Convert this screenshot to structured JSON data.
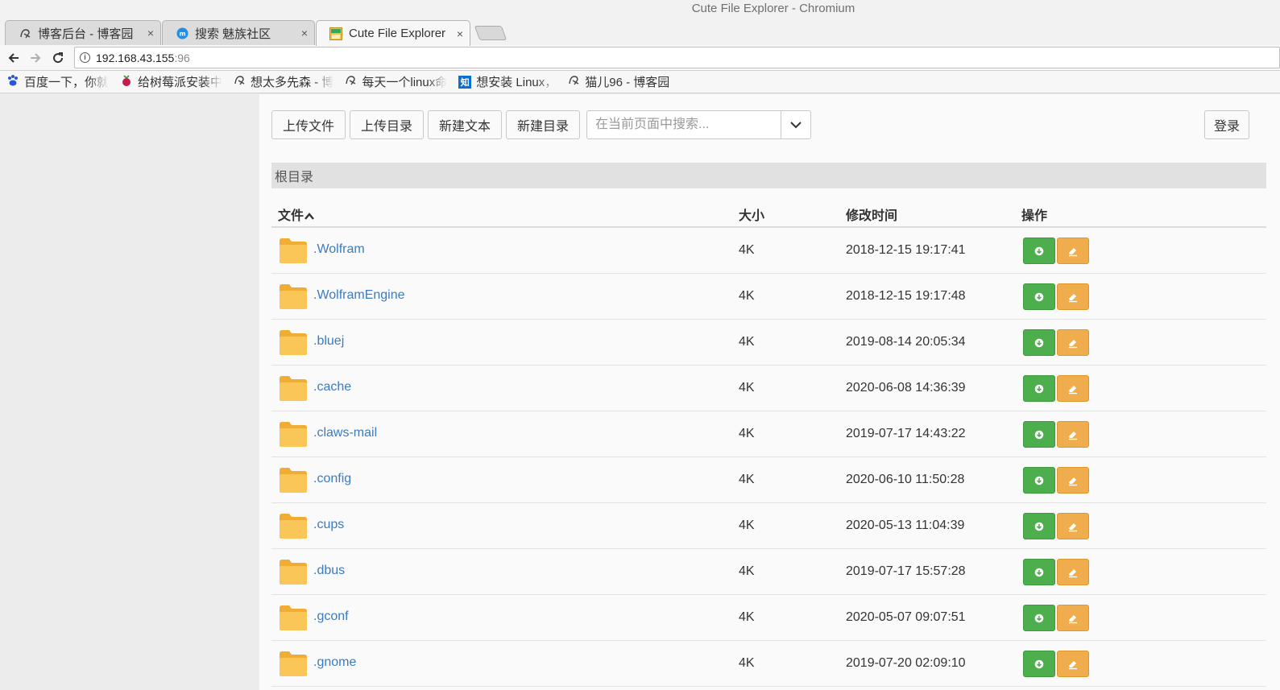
{
  "window": {
    "title": "Cute File Explorer - Chromium"
  },
  "tabs": [
    {
      "label": "博客后台 - 博客园",
      "icon": "cnblogs-icon",
      "close": "×"
    },
    {
      "label": "搜索 魅族社区",
      "icon": "meizu-icon",
      "close": "×"
    },
    {
      "label": "Cute File Explorer",
      "icon": "cute-file-explorer-icon",
      "close": "×"
    }
  ],
  "address": {
    "host": "192.168.43.155",
    "port": ":96",
    "info": "i"
  },
  "bookmarks": [
    {
      "label": "百度一下，你就",
      "icon": "baidu-icon"
    },
    {
      "label": "给树莓派安装中",
      "icon": "raspberry-pi-icon"
    },
    {
      "label": "想太多先森 - 博",
      "icon": "cnblogs-icon"
    },
    {
      "label": "每天一个linux命",
      "icon": "cnblogs-icon"
    },
    {
      "label": "想安装 Linux，",
      "icon": "zhihu-icon",
      "badge": "知"
    },
    {
      "label": "猫儿96 - 博客园",
      "icon": "cnblogs-icon"
    }
  ],
  "actions": {
    "upload_file": "上传文件",
    "upload_dir": "上传目录",
    "new_text": "新建文本",
    "new_dir": "新建目录",
    "search_placeholder": "在当前页面中搜索...",
    "login": "登录"
  },
  "breadcrumb": "根目录",
  "table": {
    "headers": {
      "name": "文件",
      "size": "大小",
      "mtime": "修改时间",
      "ops": "操作"
    },
    "rows": [
      {
        "name": ".Wolfram",
        "size": "4K",
        "mtime": "2018-12-15 19:17:41"
      },
      {
        "name": ".WolframEngine",
        "size": "4K",
        "mtime": "2018-12-15 19:17:48"
      },
      {
        "name": ".bluej",
        "size": "4K",
        "mtime": "2019-08-14 20:05:34"
      },
      {
        "name": ".cache",
        "size": "4K",
        "mtime": "2020-06-08 14:36:39"
      },
      {
        "name": ".claws-mail",
        "size": "4K",
        "mtime": "2019-07-17 14:43:22"
      },
      {
        "name": ".config",
        "size": "4K",
        "mtime": "2020-06-10 11:50:28"
      },
      {
        "name": ".cups",
        "size": "4K",
        "mtime": "2020-05-13 11:04:39"
      },
      {
        "name": ".dbus",
        "size": "4K",
        "mtime": "2019-07-17 15:57:28"
      },
      {
        "name": ".gconf",
        "size": "4K",
        "mtime": "2020-05-07 09:07:51"
      },
      {
        "name": ".gnome",
        "size": "4K",
        "mtime": "2019-07-20 02:09:10"
      }
    ]
  },
  "colors": {
    "link": "#3a7bc1",
    "download_button": "#4cae4c",
    "edit_button": "#f0ad4e",
    "folder": "#fbc658"
  }
}
